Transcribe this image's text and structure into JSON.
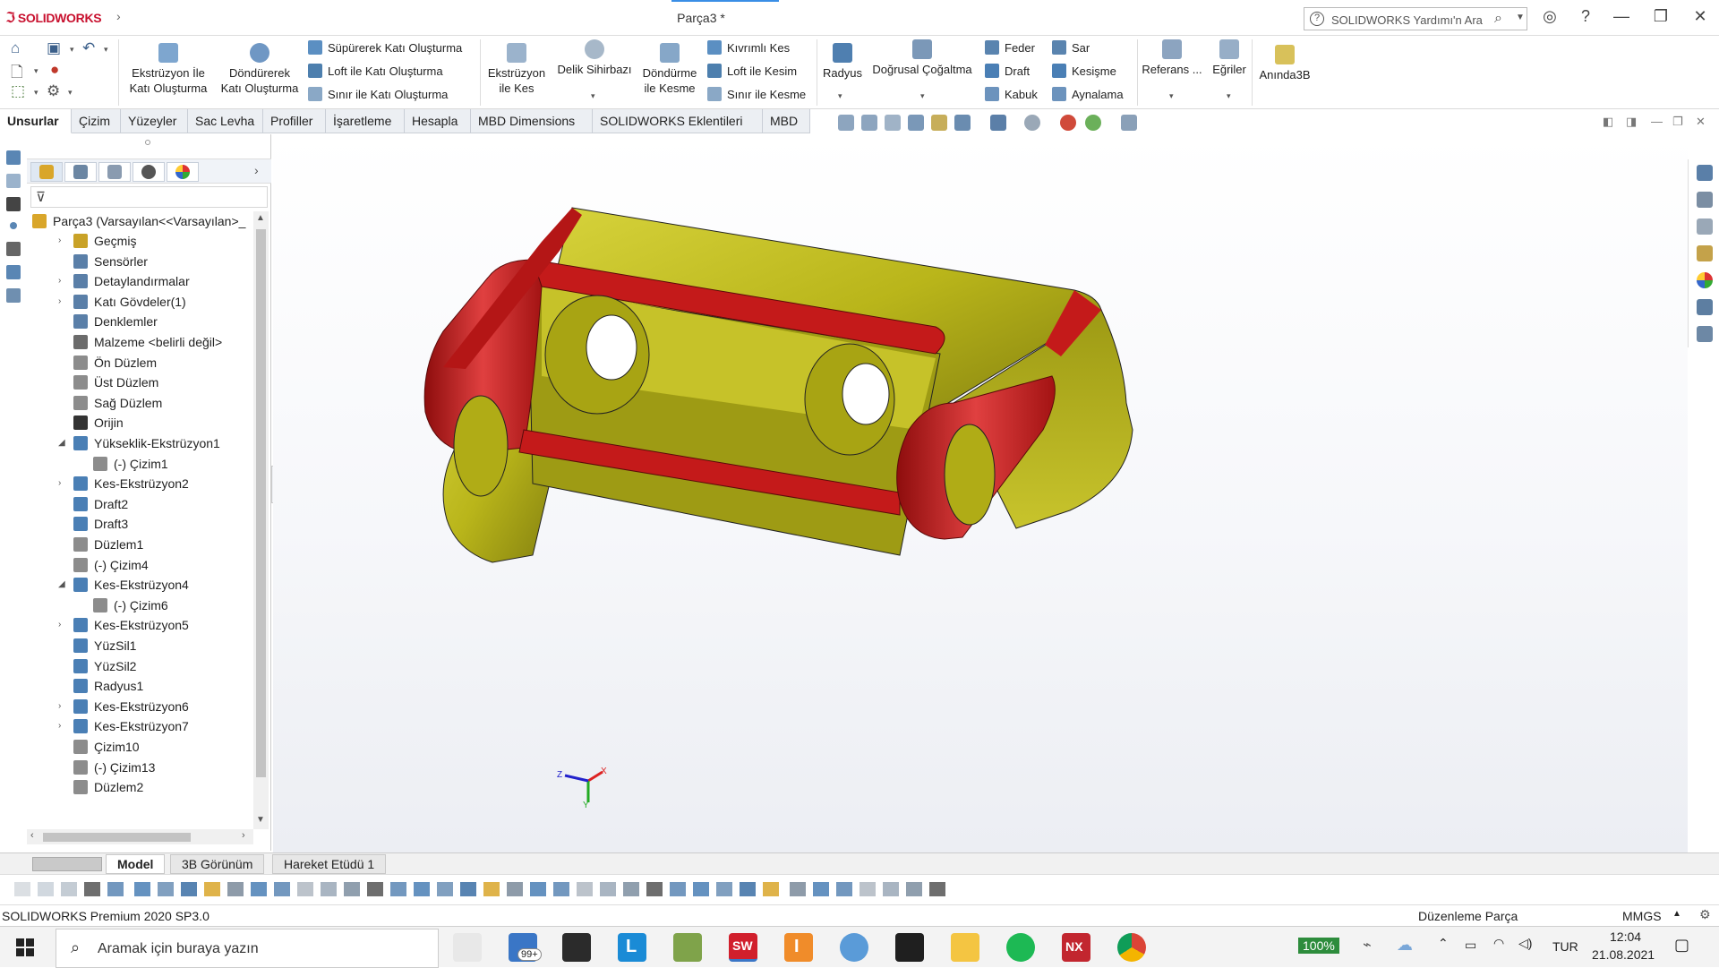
{
  "window": {
    "brand": "SOLIDWORKS",
    "document_title": "Parça3 *",
    "search_placeholder": "SOLIDWORKS Yardımı'n Ara"
  },
  "command_manager": {
    "big_buttons": [
      {
        "id": "extrude-boss",
        "label": "Ekstrüzyon İle\nKatı Oluşturma"
      },
      {
        "id": "revolve-boss",
        "label": "Döndürerek\nKatı Oluşturma"
      },
      {
        "id": "extrude-cut",
        "label": "Ekstrüzyon\nile Kes"
      },
      {
        "id": "hole-wizard",
        "label": "Delik Sihirbazı"
      },
      {
        "id": "revolve-cut",
        "label": "Döndürme\nile Kesme"
      },
      {
        "id": "fillet",
        "label": "Radyus"
      },
      {
        "id": "linear-pattern",
        "label": "Doğrusal Çoğaltma"
      },
      {
        "id": "reference",
        "label": "Referans ..."
      },
      {
        "id": "curves",
        "label": "Eğriler"
      },
      {
        "id": "instant3d",
        "label": "Anında3B"
      }
    ],
    "small_buttons": [
      {
        "id": "swept-boss",
        "label": "Süpürerek Katı Oluşturma"
      },
      {
        "id": "loft-boss",
        "label": "Loft ile Katı Oluşturma"
      },
      {
        "id": "boundary-boss",
        "label": "Sınır ile Katı Oluşturma"
      },
      {
        "id": "swept-cut",
        "label": "Kıvrımlı Kes"
      },
      {
        "id": "loft-cut",
        "label": "Loft ile Kesim"
      },
      {
        "id": "boundary-cut",
        "label": "Sınır ile Kesme"
      },
      {
        "id": "rib",
        "label": "Feder"
      },
      {
        "id": "draft",
        "label": "Draft"
      },
      {
        "id": "shell",
        "label": "Kabuk"
      },
      {
        "id": "wrap",
        "label": "Sar"
      },
      {
        "id": "intersect",
        "label": "Kesişme"
      },
      {
        "id": "mirror",
        "label": "Aynalama"
      }
    ]
  },
  "tabs": [
    "Unsurlar",
    "Çizim",
    "Yüzeyler",
    "Sac Levha",
    "Profiller",
    "İşaretleme",
    "Hesapla",
    "MBD Dimensions",
    "SOLIDWORKS Eklentileri",
    "MBD"
  ],
  "active_tab": "Unsurlar",
  "feature_tree": {
    "root": "Parça3  (Varsayılan<<Varsayılan>_",
    "items": [
      {
        "label": "Geçmiş",
        "indent": 0,
        "expander": true,
        "icon": "history-icon",
        "color": "#c9a227"
      },
      {
        "label": "Sensörler",
        "indent": 0,
        "expander": false,
        "icon": "sensor-icon",
        "color": "#5a7fa8"
      },
      {
        "label": "Detaylandırmalar",
        "indent": 0,
        "expander": true,
        "icon": "annotation-icon",
        "color": "#5a7fa8"
      },
      {
        "label": "Katı Gövdeler(1)",
        "indent": 0,
        "expander": true,
        "icon": "solid-bodies-icon",
        "color": "#5a7fa8"
      },
      {
        "label": "Denklemler",
        "indent": 0,
        "expander": false,
        "icon": "equation-icon",
        "color": "#5a7fa8"
      },
      {
        "label": "Malzeme <belirli değil>",
        "indent": 0,
        "expander": false,
        "icon": "material-icon",
        "color": "#6b6b6b"
      },
      {
        "label": "Ön Düzlem",
        "indent": 0,
        "expander": false,
        "icon": "plane-icon",
        "color": "#8c8c8c"
      },
      {
        "label": "Üst Düzlem",
        "indent": 0,
        "expander": false,
        "icon": "plane-icon",
        "color": "#8c8c8c"
      },
      {
        "label": "Sağ Düzlem",
        "indent": 0,
        "expander": false,
        "icon": "plane-icon",
        "color": "#8c8c8c"
      },
      {
        "label": "Orijin",
        "indent": 0,
        "expander": false,
        "icon": "origin-icon",
        "color": "#333333"
      },
      {
        "label": "Yükseklik-Ekstrüzyon1",
        "indent": 0,
        "expander": "open",
        "icon": "extrude-icon",
        "color": "#4a7fb5"
      },
      {
        "label": "(-) Çizim1",
        "indent": 1,
        "expander": false,
        "icon": "sketch-icon",
        "color": "#8c8c8c"
      },
      {
        "label": "Kes-Ekstrüzyon2",
        "indent": 0,
        "expander": true,
        "icon": "cut-extrude-icon",
        "color": "#4a7fb5"
      },
      {
        "label": "Draft2",
        "indent": 0,
        "expander": false,
        "icon": "draft-icon",
        "color": "#4a7fb5"
      },
      {
        "label": "Draft3",
        "indent": 0,
        "expander": false,
        "icon": "draft-icon",
        "color": "#4a7fb5"
      },
      {
        "label": "Düzlem1",
        "indent": 0,
        "expander": false,
        "icon": "plane-icon",
        "color": "#8c8c8c"
      },
      {
        "label": "(-) Çizim4",
        "indent": 0,
        "expander": false,
        "icon": "sketch-icon",
        "color": "#8c8c8c"
      },
      {
        "label": "Kes-Ekstrüzyon4",
        "indent": 0,
        "expander": "open",
        "icon": "cut-extrude-icon",
        "color": "#4a7fb5"
      },
      {
        "label": "(-) Çizim6",
        "indent": 1,
        "expander": false,
        "icon": "sketch-icon",
        "color": "#8c8c8c"
      },
      {
        "label": "Kes-Ekstrüzyon5",
        "indent": 0,
        "expander": true,
        "icon": "cut-extrude-icon",
        "color": "#4a7fb5"
      },
      {
        "label": "YüzSil1",
        "indent": 0,
        "expander": false,
        "icon": "delete-face-icon",
        "color": "#4a7fb5"
      },
      {
        "label": "YüzSil2",
        "indent": 0,
        "expander": false,
        "icon": "delete-face-icon",
        "color": "#4a7fb5"
      },
      {
        "label": "Radyus1",
        "indent": 0,
        "expander": false,
        "icon": "fillet-icon",
        "color": "#4a7fb5"
      },
      {
        "label": "Kes-Ekstrüzyon6",
        "indent": 0,
        "expander": true,
        "icon": "cut-extrude-icon",
        "color": "#4a7fb5"
      },
      {
        "label": "Kes-Ekstrüzyon7",
        "indent": 0,
        "expander": true,
        "icon": "cut-extrude-icon",
        "color": "#4a7fb5"
      },
      {
        "label": "Çizim10",
        "indent": 0,
        "expander": false,
        "icon": "sketch-icon",
        "color": "#8c8c8c"
      },
      {
        "label": "(-) Çizim13",
        "indent": 0,
        "expander": false,
        "icon": "sketch-icon",
        "color": "#8c8c8c"
      },
      {
        "label": "Düzlem2",
        "indent": 0,
        "expander": false,
        "icon": "plane-icon",
        "color": "#8c8c8c"
      }
    ]
  },
  "bottom_tabs": [
    "Model",
    "3B Görünüm",
    "Hareket Etüdü 1"
  ],
  "active_bottom_tab": "Model",
  "triad": {
    "x": "X",
    "y": "Y",
    "z": "Z"
  },
  "status_bar": {
    "version": "SOLIDWORKS Premium 2020 SP3.0",
    "mode": "Düzenleme Parça",
    "units": "MMGS"
  },
  "taskbar": {
    "search_placeholder": "Aramak için buraya yazın",
    "mail_badge": "99+",
    "battery": "100%",
    "language": "TUR",
    "time": "12:04",
    "date": "21.08.2021"
  },
  "colors": {
    "part_body": "#b9b51a",
    "fillet_faces": "#c41a1a",
    "accent": "#3a8ee6"
  }
}
